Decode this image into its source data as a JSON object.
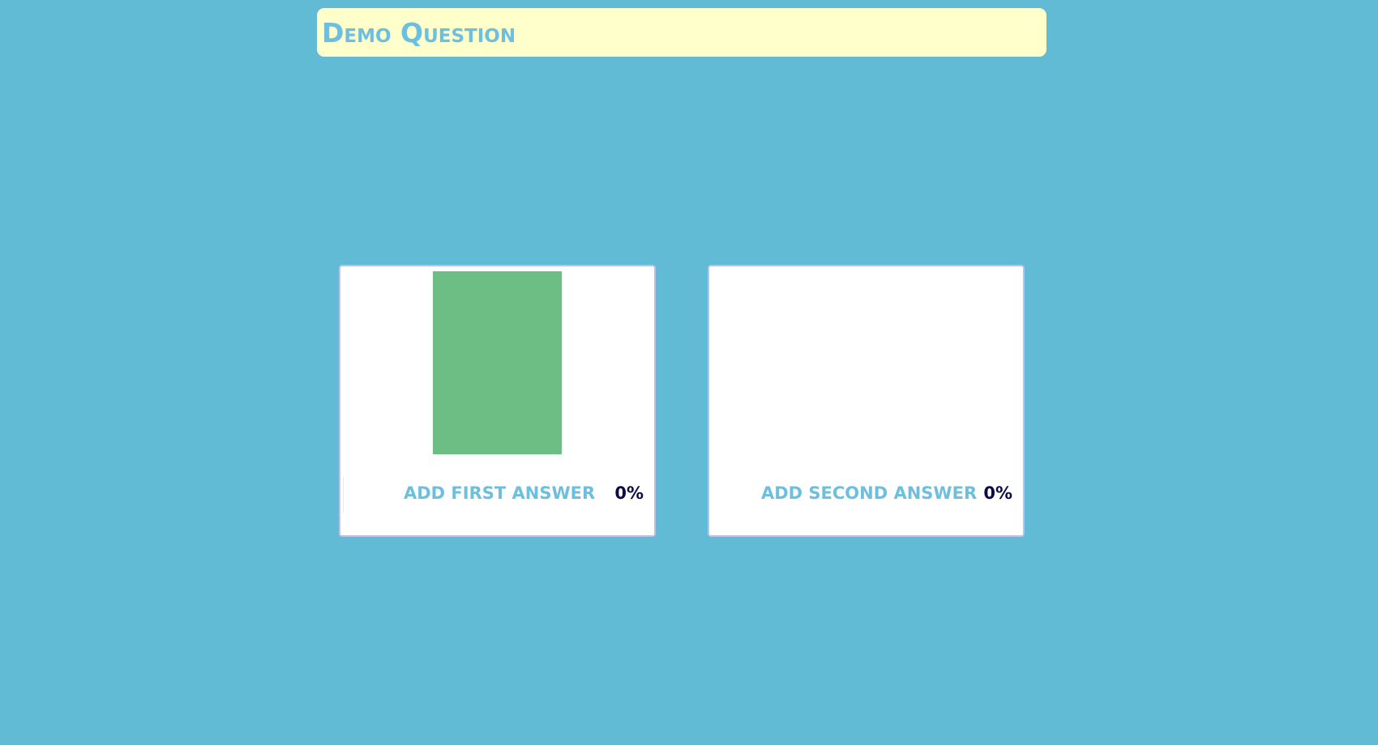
{
  "question": {
    "title": "Demo Question"
  },
  "answers": [
    {
      "label": "Add first answer",
      "percent_text": "0%",
      "bar_color": "#6cbe85"
    },
    {
      "label": "Add second answer",
      "percent_text": "0%"
    }
  ],
  "colors": {
    "background": "#61bbd4",
    "banner": "#ffffcb",
    "accent_text": "#6cbfdf",
    "percent_text": "#0e0a45",
    "card_border": "#b9c1f0"
  }
}
